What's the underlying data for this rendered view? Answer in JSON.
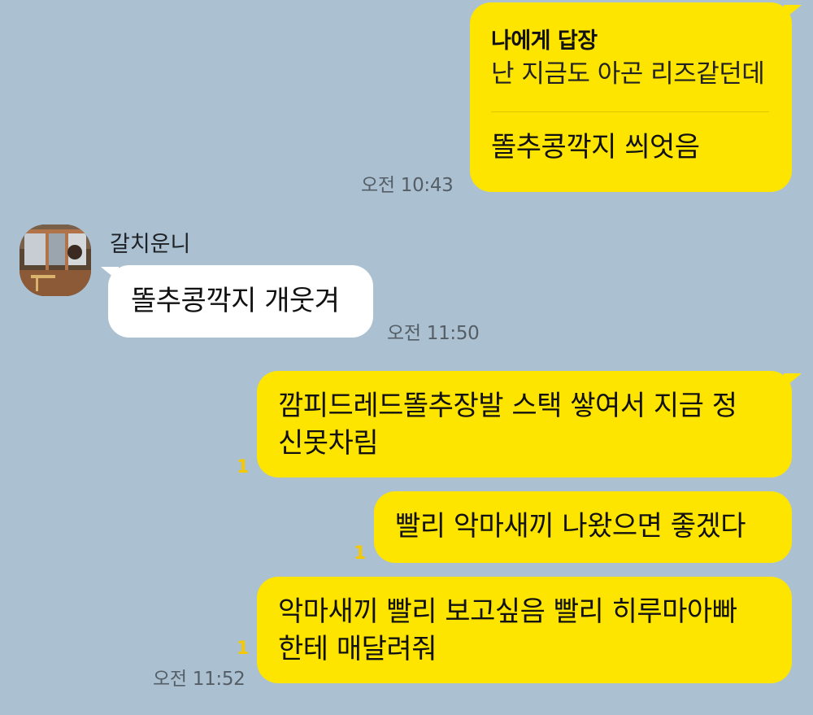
{
  "messages": [
    {
      "reply_header": "나에게 답장",
      "reply_quote": "난 지금도 아곤 리즈같던데",
      "text": "똘추콩깍지 씌엇음",
      "time": "오전 10:43"
    },
    {
      "sender": "갈치운니",
      "text": "똘추콩깍지 개웃겨",
      "time": "오전 11:50"
    },
    {
      "line1": "깜피드레드똘추장발 스택 쌓여서 지금 정",
      "line2": "신못차림",
      "unread": "1"
    },
    {
      "text": "빨리 악마새끼 나왔으면 좋겠다",
      "unread": "1"
    },
    {
      "line1": "악마새끼 빨리 보고싶음 빨리 히루마아빠",
      "line2": "한테 매달려줘",
      "unread": "1",
      "time": "오전 11:52"
    }
  ],
  "colors": {
    "background": "#abc1d1",
    "my_bubble": "#fee500",
    "their_bubble": "#ffffff",
    "unread_count": "#f5c800"
  },
  "icons": {
    "avatar": "profile-photo-avatar"
  }
}
